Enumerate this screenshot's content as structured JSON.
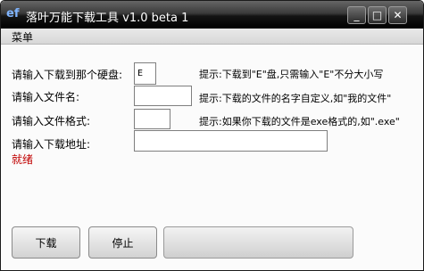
{
  "window": {
    "title": "落叶万能下载工具 v1.0 beta 1",
    "app_icon_glyph": "ef",
    "controls": {
      "minimize": "_",
      "maximize": "□",
      "close": "✕"
    }
  },
  "menu": {
    "items": [
      {
        "label": "菜单"
      }
    ]
  },
  "form": {
    "drive": {
      "label": "请输入下载到那个硬盘:",
      "value": "E",
      "hint": "提示:下载到\"E\"盘,只需输入\"E\"不分大小写"
    },
    "filename": {
      "label": "请输入文件名:",
      "value": "",
      "hint": "提示:下载的文件的名字自定义,如\"我的文件\""
    },
    "format": {
      "label": "请输入文件格式:",
      "value": "",
      "hint": "提示:如果你下载的文件是exe格式的,如\".exe\""
    },
    "url": {
      "label": "请输入下载地址:",
      "value": ""
    }
  },
  "status": {
    "text": "就绪",
    "color": "#c00000"
  },
  "buttons": {
    "download": "下载",
    "stop": "停止"
  },
  "progress": {
    "value": 0
  }
}
